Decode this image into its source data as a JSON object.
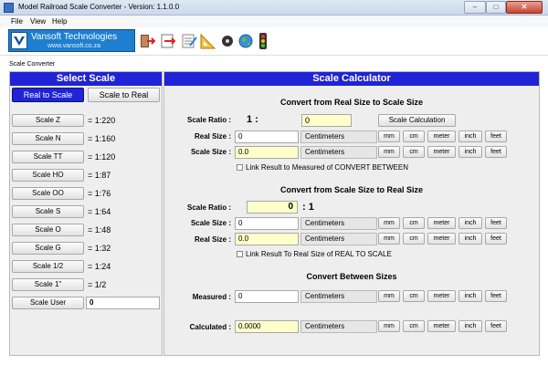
{
  "window": {
    "title": "Model Railroad Scale Converter - Version: 1.1.0.0",
    "minimize": "–",
    "maximize": "□",
    "close": "✕"
  },
  "menu": [
    "File",
    "View",
    "Help"
  ],
  "logo": {
    "name": "Vansoft Technologies",
    "url": "www.vansoft.co.za"
  },
  "toolbar_icons": [
    "exit-icon",
    "export-icon",
    "notepad-icon",
    "ruler-icon",
    "train-wheel-icon",
    "globe-icon",
    "traffic-light-icon"
  ],
  "caption": "Scale Converter",
  "left": {
    "header": "Select Scale",
    "mode_tabs": [
      "Real to Scale",
      "Scale to Real"
    ],
    "scales": [
      {
        "name": "Scale Z",
        "ratio": "= 1:220"
      },
      {
        "name": "Scale N",
        "ratio": "= 1:160"
      },
      {
        "name": "Scale TT",
        "ratio": "= 1:120"
      },
      {
        "name": "Scale HO",
        "ratio": "= 1:87"
      },
      {
        "name": "Scale OO",
        "ratio": "= 1:76"
      },
      {
        "name": "Scale S",
        "ratio": "= 1:64"
      },
      {
        "name": "Scale O",
        "ratio": "= 1:48"
      },
      {
        "name": "Scale G",
        "ratio": "= 1:32"
      },
      {
        "name": "Scale 1/2",
        "ratio": "= 1:24"
      },
      {
        "name": "Scale 1\"",
        "ratio": "= 1/2"
      }
    ],
    "user": {
      "label": "Scale User",
      "value": "0"
    }
  },
  "calc": {
    "header": "Scale Calculator",
    "unit_buttons": [
      "mm",
      "cm",
      "meter",
      "inch",
      "feet"
    ],
    "sec1": {
      "title": "Convert from Real Size to Scale Size",
      "ratio_label": "Scale Ratio :",
      "ratio_prefix": "1 :",
      "ratio_value": "0",
      "calc_button": "Scale Calculation",
      "real_label": "Real Size :",
      "real_value": "0",
      "real_unit": "Centimeters",
      "scale_label": "Scale Size :",
      "scale_value": "0.0",
      "scale_unit": "Centimeters",
      "link": "Link Result to Measured of CONVERT BETWEEN"
    },
    "sec2": {
      "title": "Convert from Scale Size to Real Size",
      "ratio_label": "Scale Ratio :",
      "ratio_value": "0",
      "ratio_suffix": ": 1",
      "scale_label": "Scale Size :",
      "scale_value": "0",
      "scale_unit": "Centimeters",
      "real_label": "Real Size :",
      "real_value": "0.0",
      "real_unit": "Centimeters",
      "link": "Link Result To Real Size of REAL TO SCALE"
    },
    "sec3": {
      "title": "Convert Between Sizes",
      "measured_label": "Measured :",
      "measured_value": "0",
      "measured_unit": "Centimeters",
      "calculated_label": "Calculated :",
      "calculated_value": "0.0000",
      "calculated_unit": "Centimeters"
    }
  }
}
